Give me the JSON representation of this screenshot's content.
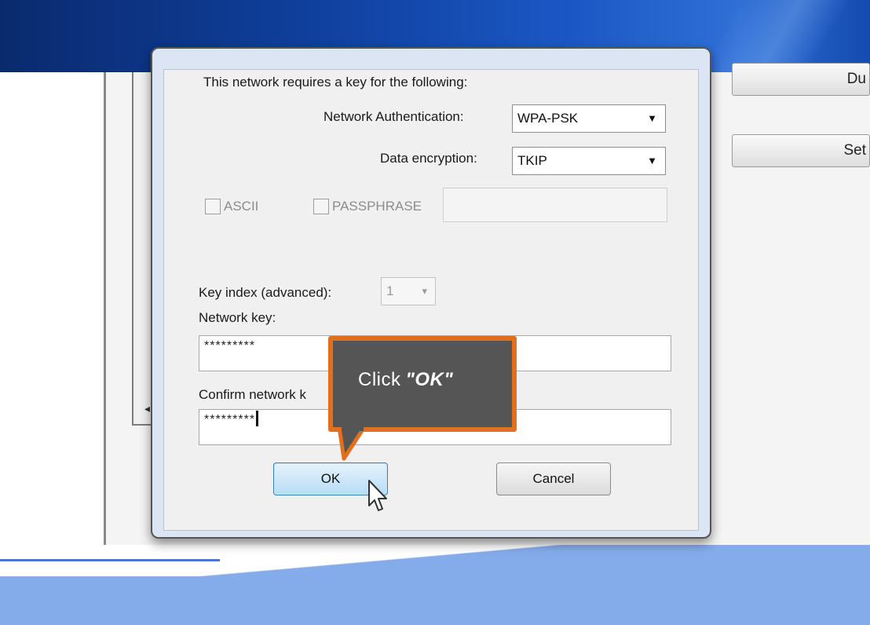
{
  "background": {
    "side_buttons": [
      "Du",
      "Set"
    ]
  },
  "dialog": {
    "requires_key_text": "This network requires a key for the following:",
    "auth_label": "Network Authentication:",
    "auth_value": "WPA-PSK",
    "encryption_label": "Data encryption:",
    "encryption_value": "TKIP",
    "ascii_label": "ASCII",
    "passphrase_label": "PASSPHRASE",
    "key_index_label": "Key index (advanced):",
    "key_index_value": "1",
    "network_key_label": "Network key:",
    "network_key_value": "*********",
    "confirm_key_label": "Confirm network k",
    "confirm_key_value": "*********",
    "ok_label": "OK",
    "cancel_label": "Cancel"
  },
  "callout": {
    "prefix": "Click",
    "target": "\"OK\"",
    "border_color": "#e0701e",
    "fill_color": "#555555"
  },
  "icons": {
    "caret": "chevron-down-icon",
    "pointer": "mouse-pointer-icon"
  }
}
